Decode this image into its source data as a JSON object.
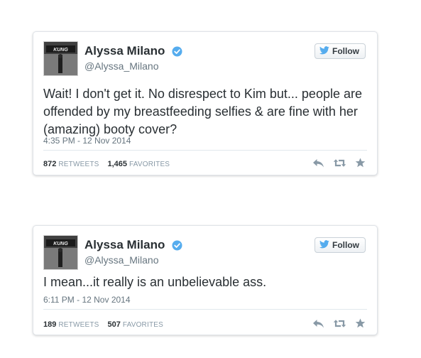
{
  "tweets": [
    {
      "display_name": "Alyssa Milano",
      "handle": "@Alyssa_Milano",
      "follow_label": "Follow",
      "text": "Wait! I don't get it. No disrespect to Kim but... people are offended by my breastfeeding selfies & are fine with her (amazing) booty cover?",
      "timestamp": "4:35 PM - 12 Nov 2014",
      "retweets_count": "872",
      "retweets_label": "RETWEETS",
      "favorites_count": "1,465",
      "favorites_label": "FAVORITES"
    },
    {
      "display_name": "Alyssa Milano",
      "handle": "@Alyssa_Milano",
      "follow_label": "Follow",
      "text": "I mean...it really is an unbelievable ass.",
      "timestamp": "6:11 PM - 12 Nov 2014",
      "retweets_count": "189",
      "retweets_label": "RETWEETS",
      "favorites_count": "507",
      "favorites_label": "FAVORITES"
    }
  ],
  "icons": {
    "verified": "verified-badge-icon",
    "follow": "twitter-bird-icon",
    "reply": "reply-icon",
    "retweet": "retweet-icon",
    "favorite": "star-icon"
  },
  "colors": {
    "verified_blue": "#55acee",
    "text": "#292f33",
    "secondary": "#66757f",
    "action_icon": "#8899a6"
  }
}
